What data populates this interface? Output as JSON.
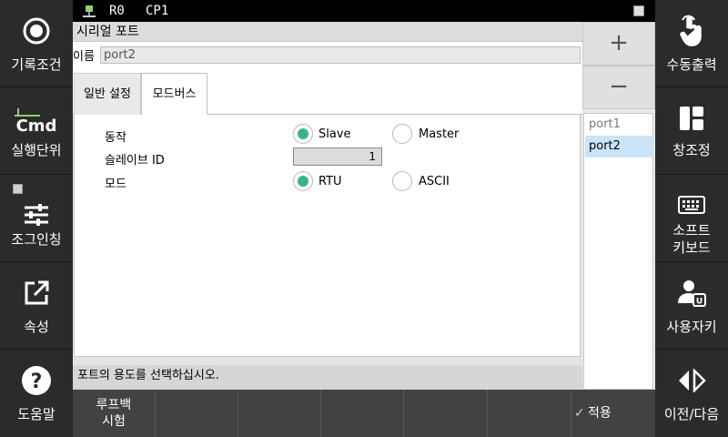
{
  "status": {
    "robot": "R0",
    "cp": "CP1"
  },
  "left_menu": [
    {
      "label": "기록조건",
      "icon": "record-icon"
    },
    {
      "label": "실행단위",
      "icon": "cmd-icon",
      "icon_text": "Cmd"
    },
    {
      "label": "조그인칭",
      "icon": "sliders-icon"
    },
    {
      "label": "속성",
      "icon": "external-link-icon"
    },
    {
      "label": "도움말",
      "icon": "help-icon"
    }
  ],
  "right_menu": [
    {
      "label": "수동출력",
      "icon": "hand-pointer-icon"
    },
    {
      "label": "창조정",
      "icon": "window-layout-icon"
    },
    {
      "label": "소프트\n키보드",
      "icon": "keyboard-icon"
    },
    {
      "label": "사용자키",
      "icon": "user-key-icon"
    },
    {
      "label": "이전/다음",
      "icon": "prev-next-icon"
    }
  ],
  "window": {
    "title": "시리얼 포트",
    "name_label": "이름",
    "name_value": "port2"
  },
  "tabs": [
    {
      "label": "일반 설정",
      "active": false
    },
    {
      "label": "모드버스",
      "active": true
    }
  ],
  "form": {
    "action_label": "동작",
    "action_options": [
      "Slave",
      "Master"
    ],
    "action_selected": "Slave",
    "slave_id_label": "슬레이브 ID",
    "slave_id_value": "1",
    "mode_label": "모드",
    "mode_options": [
      "RTU",
      "ASCII"
    ],
    "mode_selected": "RTU"
  },
  "hint": "포트의 용도를 선택하십시오.",
  "ports": {
    "add": "+",
    "remove": "−",
    "items": [
      "port1",
      "port2"
    ],
    "selected": "port2"
  },
  "bottom": {
    "loopback": "루프백\n시험",
    "apply": "적용"
  },
  "colors": {
    "radio_on": "#3bb38a",
    "selected_item": "#cce4f7",
    "panel": "#2b2b2b"
  }
}
